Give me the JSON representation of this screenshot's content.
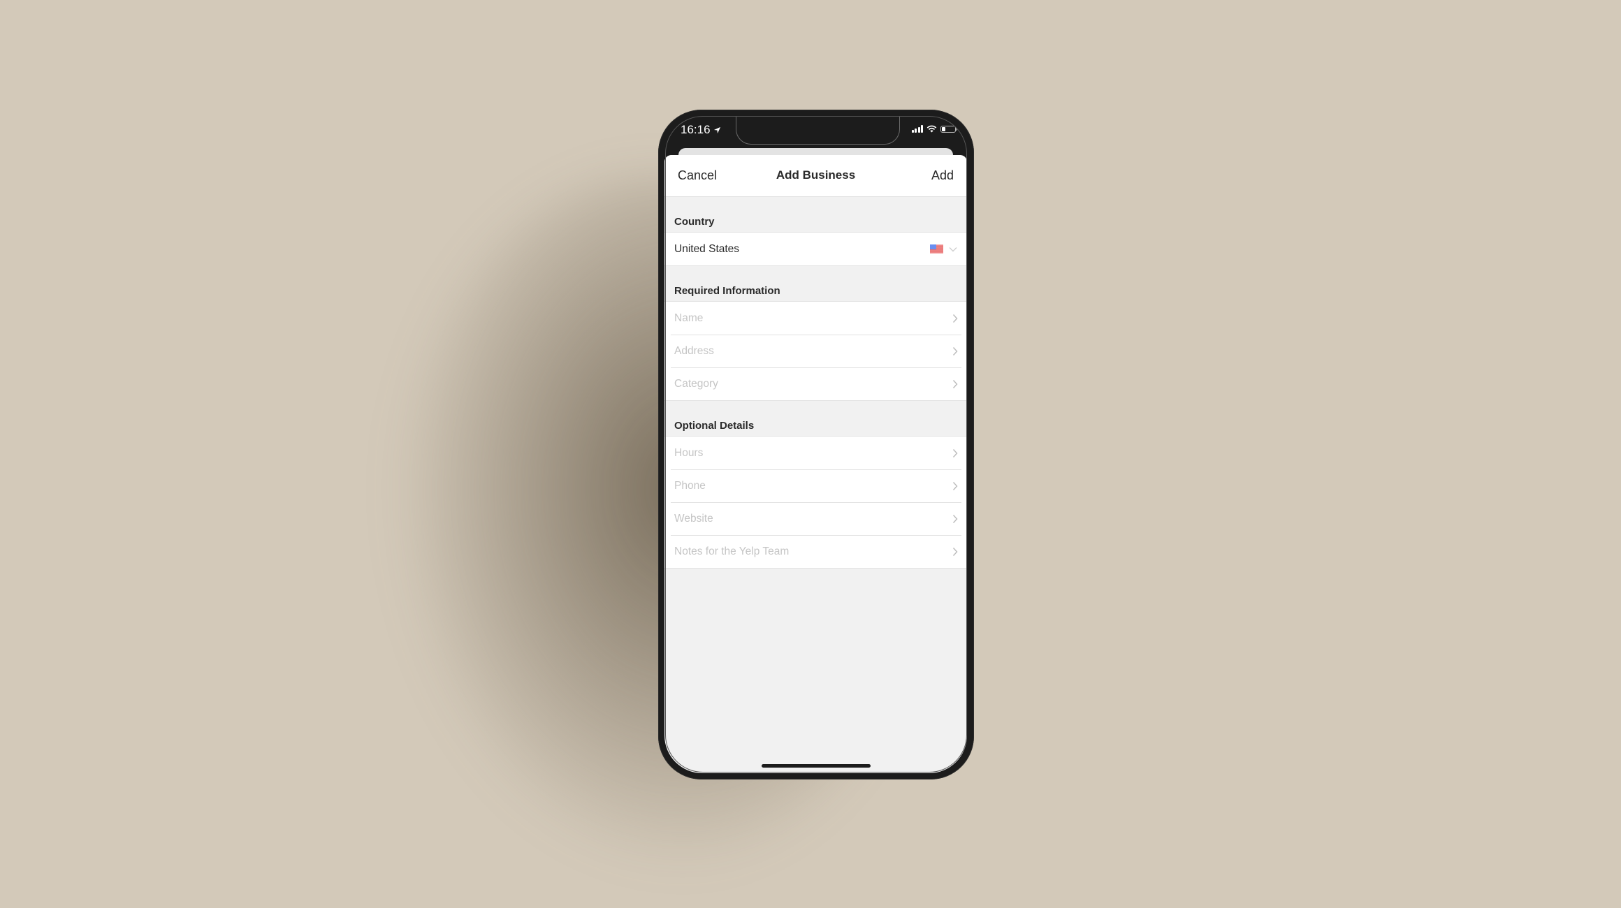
{
  "status_bar": {
    "time": "16:16",
    "icons": [
      "location-arrow-icon",
      "cellular-signal-icon",
      "wifi-icon",
      "battery-icon"
    ],
    "battery_level": 0.25
  },
  "navbar": {
    "cancel_label": "Cancel",
    "title": "Add Business",
    "add_label": "Add"
  },
  "sections": [
    {
      "header": "Country",
      "rows": [
        {
          "label": "United States",
          "type": "value",
          "accessory": "us-flag-icon chevron-down-icon"
        }
      ]
    },
    {
      "header": "Required Information",
      "rows": [
        {
          "label": "Name",
          "type": "placeholder",
          "accessory": "chevron-right-icon"
        },
        {
          "label": "Address",
          "type": "placeholder",
          "accessory": "chevron-right-icon"
        },
        {
          "label": "Category",
          "type": "placeholder",
          "accessory": "chevron-right-icon"
        }
      ]
    },
    {
      "header": "Optional Details",
      "rows": [
        {
          "label": "Hours",
          "type": "placeholder",
          "accessory": "chevron-right-icon"
        },
        {
          "label": "Phone",
          "type": "placeholder",
          "accessory": "chevron-right-icon"
        },
        {
          "label": "Website",
          "type": "placeholder",
          "accessory": "chevron-right-icon"
        },
        {
          "label": "Notes for the Yelp Team",
          "type": "placeholder",
          "accessory": "chevron-right-icon"
        }
      ]
    }
  ],
  "colors": {
    "background": "#d3c9b9",
    "phone_frame": "#1c1c1c",
    "sheet_bg": "#f1f1f1",
    "text_primary": "#2a2a2a",
    "text_placeholder": "#c5c5c5",
    "separator": "#e2e2e2"
  }
}
